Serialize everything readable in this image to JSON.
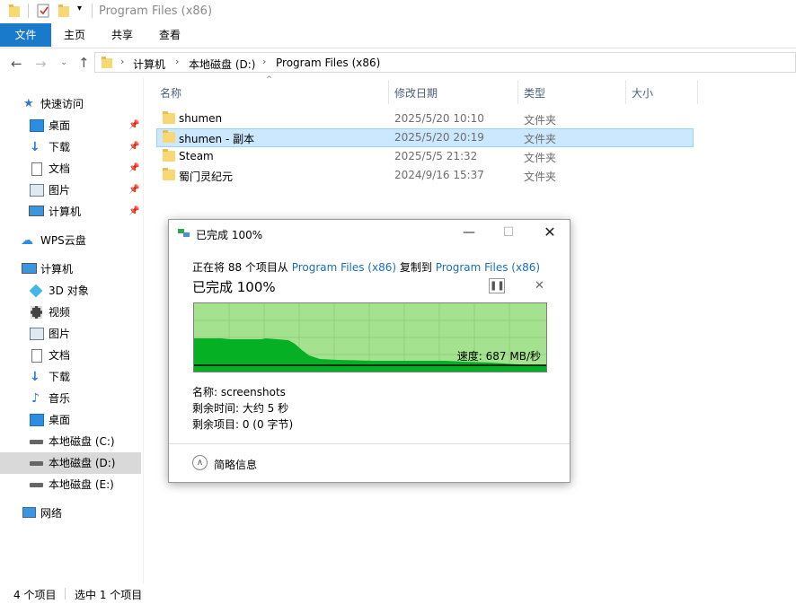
{
  "window": {
    "title": "Program Files (x86)"
  },
  "ribbon": {
    "tabs": [
      "文件",
      "主页",
      "共享",
      "查看"
    ]
  },
  "address": {
    "crumbs": [
      "计算机",
      "本地磁盘 (D:)",
      "Program Files (x86)"
    ]
  },
  "nav": {
    "quick_access": "快速访问",
    "pinned": [
      {
        "label": "桌面",
        "icon": "desktop-icon"
      },
      {
        "label": "下载",
        "icon": "download-icon"
      },
      {
        "label": "文档",
        "icon": "document-icon"
      },
      {
        "label": "图片",
        "icon": "picture-icon"
      },
      {
        "label": "计算机",
        "icon": "computer-icon"
      }
    ],
    "wps": "WPS云盘",
    "computer": "计算机",
    "computer_items": [
      {
        "label": "3D 对象",
        "icon": "3d-objects-icon"
      },
      {
        "label": "视频",
        "icon": "video-icon"
      },
      {
        "label": "图片",
        "icon": "picture-icon"
      },
      {
        "label": "文档",
        "icon": "document-icon"
      },
      {
        "label": "下载",
        "icon": "download-icon"
      },
      {
        "label": "音乐",
        "icon": "music-icon"
      },
      {
        "label": "桌面",
        "icon": "desktop-icon"
      },
      {
        "label": "本地磁盘 (C:)",
        "icon": "drive-icon"
      },
      {
        "label": "本地磁盘 (D:)",
        "icon": "drive-icon"
      },
      {
        "label": "本地磁盘 (E:)",
        "icon": "drive-icon"
      }
    ],
    "network": "网络"
  },
  "columns": {
    "name": "名称",
    "date": "修改日期",
    "type": "类型",
    "size": "大小"
  },
  "files": [
    {
      "name": "shumen",
      "date": "2025/5/20 10:10",
      "type": "文件夹"
    },
    {
      "name": "shumen - 副本",
      "date": "2025/5/20 20:19",
      "type": "文件夹"
    },
    {
      "name": "Steam",
      "date": "2025/5/5 21:32",
      "type": "文件夹"
    },
    {
      "name": "蜀门灵纪元",
      "date": "2024/9/16 15:37",
      "type": "文件夹"
    }
  ],
  "status": {
    "count": "4 个项目",
    "selected": "选中 1 个项目"
  },
  "dialog": {
    "title": "已完成 100%",
    "line_prefix": "正在将 88 个项目从 ",
    "source": "Program Files (x86)",
    "line_middle": " 复制到 ",
    "dest": "Program Files (x86)",
    "heading": "已完成 100%",
    "speed": "速度: 687 MB/秒",
    "name_line": "名称: screenshots",
    "time_line": "剩余时间: 大约 5 秒",
    "items_line": "剩余项目: 0 (0 字节)",
    "details": "简略信息",
    "progress_percent": 100
  }
}
